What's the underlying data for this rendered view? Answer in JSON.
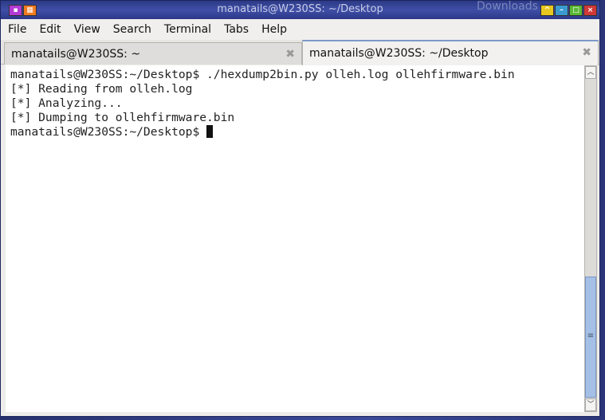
{
  "desktop": {
    "bg_label": "Downloads"
  },
  "window": {
    "title": "manatails@W230SS: ~/Desktop"
  },
  "menu": [
    "File",
    "Edit",
    "View",
    "Search",
    "Terminal",
    "Tabs",
    "Help"
  ],
  "tabs": [
    {
      "label": "manatails@W230SS: ~",
      "active": false
    },
    {
      "label": "manatails@W230SS: ~/Desktop",
      "active": true
    }
  ],
  "terminal": {
    "lines": [
      "manatails@W230SS:~/Desktop$ ./hexdump2bin.py olleh.log ollehfirmware.bin",
      "[*] Reading from olleh.log",
      "[*] Analyzing...",
      "[*] Dumping to ollehfirmware.bin"
    ],
    "prompt": "manatails@W230SS:~/Desktop$ "
  },
  "scrollbar": {
    "position_percent": 100
  }
}
